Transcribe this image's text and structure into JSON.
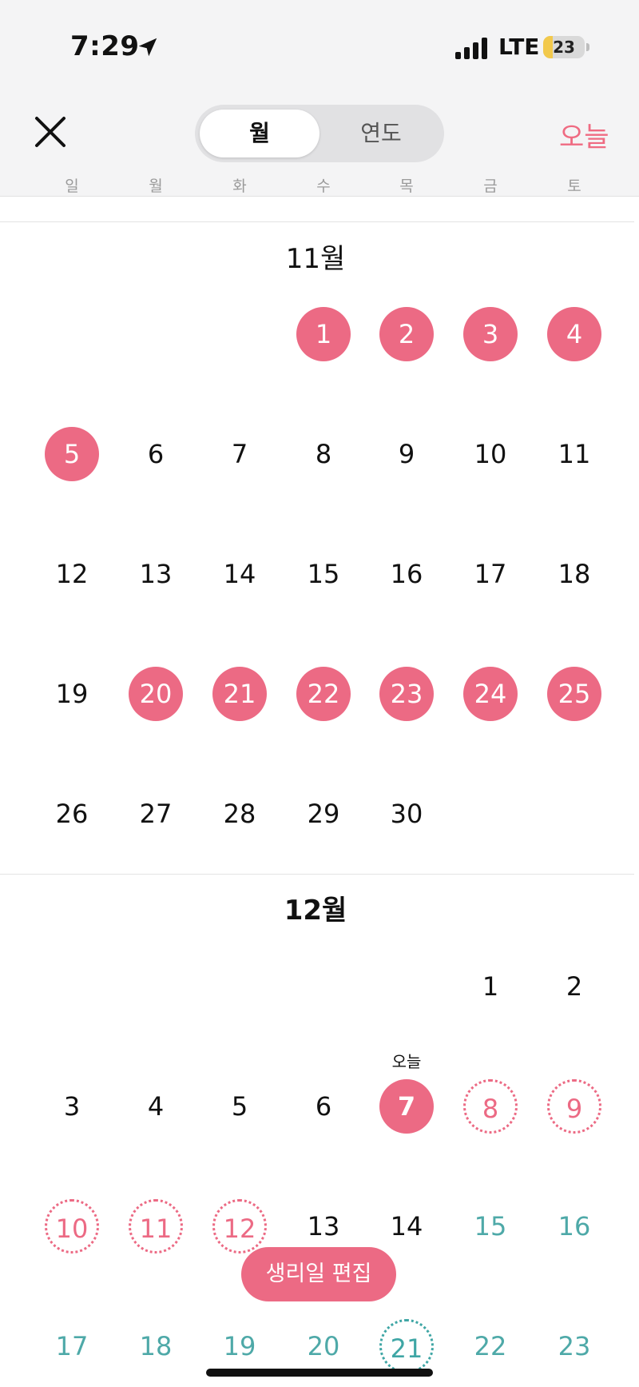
{
  "status_bar": {
    "time": "7:29",
    "network": "LTE",
    "battery": "23",
    "battery_level": 0.23
  },
  "header": {
    "segments": [
      {
        "label": "월",
        "active": true
      },
      {
        "label": "연도",
        "active": false
      }
    ],
    "today_button": "오늘",
    "weekdays": [
      "일",
      "월",
      "화",
      "수",
      "목",
      "금",
      "토"
    ]
  },
  "colors": {
    "period": "#ec6a84",
    "fertile": "#4ea9a8"
  },
  "months": [
    {
      "title": "11월",
      "weeks": [
        [
          null,
          null,
          null,
          {
            "d": "1",
            "s": "period"
          },
          {
            "d": "2",
            "s": "period"
          },
          {
            "d": "3",
            "s": "period"
          },
          {
            "d": "4",
            "s": "period"
          }
        ],
        [
          {
            "d": "5",
            "s": "period"
          },
          {
            "d": "6"
          },
          {
            "d": "7"
          },
          {
            "d": "8"
          },
          {
            "d": "9"
          },
          {
            "d": "10"
          },
          {
            "d": "11"
          }
        ],
        [
          {
            "d": "12"
          },
          {
            "d": "13"
          },
          {
            "d": "14"
          },
          {
            "d": "15"
          },
          {
            "d": "16"
          },
          {
            "d": "17"
          },
          {
            "d": "18"
          }
        ],
        [
          {
            "d": "19"
          },
          {
            "d": "20",
            "s": "period"
          },
          {
            "d": "21",
            "s": "period"
          },
          {
            "d": "22",
            "s": "period"
          },
          {
            "d": "23",
            "s": "period"
          },
          {
            "d": "24",
            "s": "period"
          },
          {
            "d": "25",
            "s": "period"
          }
        ],
        [
          {
            "d": "26"
          },
          {
            "d": "27"
          },
          {
            "d": "28"
          },
          {
            "d": "29"
          },
          {
            "d": "30"
          },
          null,
          null
        ]
      ]
    },
    {
      "title": "12월",
      "weeks": [
        [
          null,
          null,
          null,
          null,
          null,
          {
            "d": "1"
          },
          {
            "d": "2"
          }
        ],
        [
          {
            "d": "3"
          },
          {
            "d": "4"
          },
          {
            "d": "5"
          },
          {
            "d": "6"
          },
          {
            "d": "7",
            "s": "today",
            "label": "오늘"
          },
          {
            "d": "8",
            "s": "predicted"
          },
          {
            "d": "9",
            "s": "predicted"
          }
        ],
        [
          {
            "d": "10",
            "s": "predicted"
          },
          {
            "d": "11",
            "s": "predicted"
          },
          {
            "d": "12",
            "s": "predicted"
          },
          {
            "d": "13"
          },
          {
            "d": "14"
          },
          {
            "d": "15",
            "s": "fertile"
          },
          {
            "d": "16",
            "s": "fertile"
          }
        ],
        [
          {
            "d": "17",
            "s": "fertile"
          },
          {
            "d": "18",
            "s": "fertile"
          },
          {
            "d": "19",
            "s": "fertile"
          },
          {
            "d": "20",
            "s": "fertile"
          },
          {
            "d": "21",
            "s": "fertile-ring"
          },
          {
            "d": "22",
            "s": "fertile"
          },
          {
            "d": "23",
            "s": "fertile"
          }
        ]
      ]
    }
  ],
  "edit_button": "생리일 편집"
}
